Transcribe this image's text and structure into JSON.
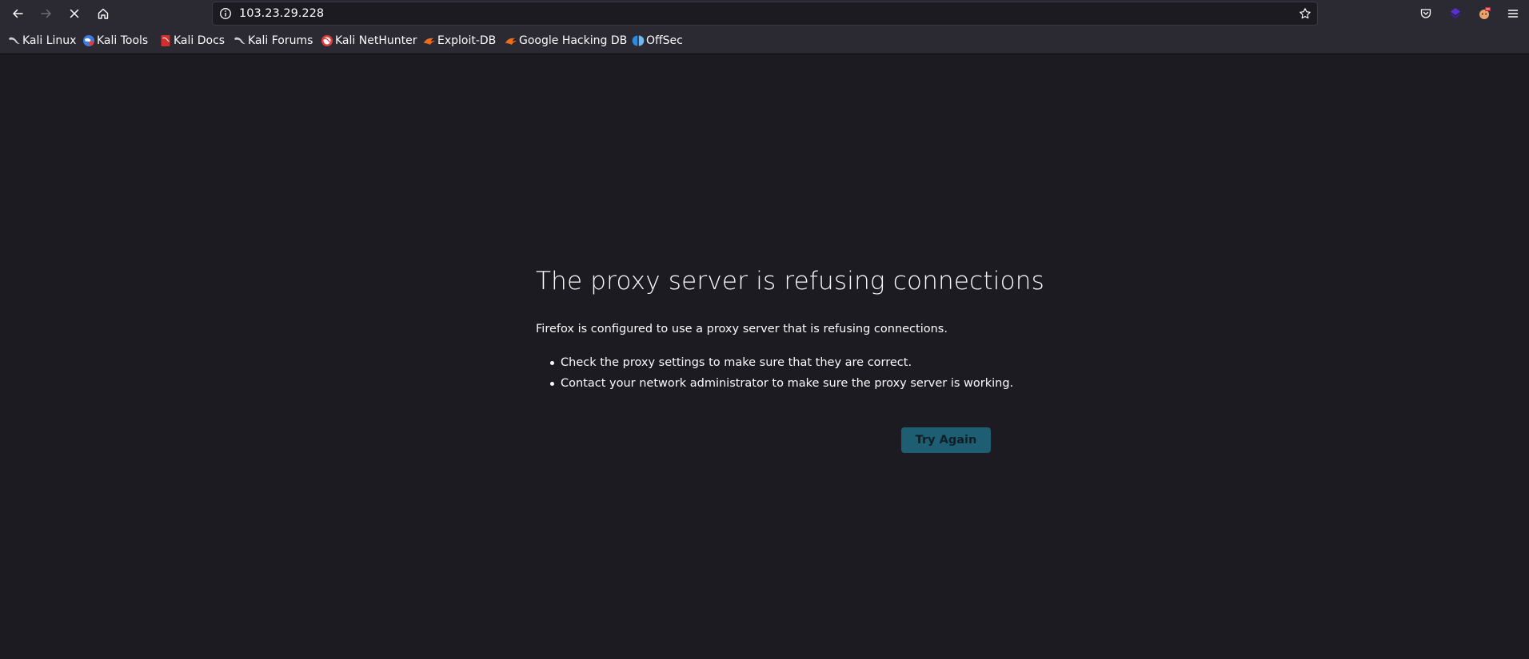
{
  "toolbar": {
    "url": "103.23.29.228",
    "icons": {
      "back": "back-arrow-icon",
      "forward": "forward-arrow-icon",
      "stop": "stop-loading-icon",
      "home": "home-icon",
      "site_info": "site-info-icon",
      "bookmark_star": "bookmark-star-icon",
      "pocket": "pocket-icon",
      "extension": "extension-icon",
      "profile": "profile-extension-icon",
      "menu": "hamburger-menu-icon"
    }
  },
  "bookmarks": [
    {
      "label": "Kali Linux",
      "icon": "kali-dragon-icon"
    },
    {
      "label": "Kali Tools",
      "icon": "kali-tools-icon"
    },
    {
      "label": "Kali Docs",
      "icon": "kali-docs-icon"
    },
    {
      "label": "Kali Forums",
      "icon": "kali-dragon-icon"
    },
    {
      "label": "Kali NetHunter",
      "icon": "nethunter-icon"
    },
    {
      "label": "Exploit-DB",
      "icon": "exploit-db-icon"
    },
    {
      "label": "Google Hacking DB",
      "icon": "exploit-db-icon"
    },
    {
      "label": "OffSec",
      "icon": "offsec-icon"
    }
  ],
  "error": {
    "title": "The proxy server is refusing connections",
    "description": "Firefox is configured to use a proxy server that is refusing connections.",
    "suggestions": [
      "Check the proxy settings to make sure that they are correct.",
      "Contact your network administrator to make sure the proxy server is working."
    ],
    "button_label": "Try Again"
  },
  "colors": {
    "page_background": "#1c1b22",
    "chrome_background": "#2b2a33",
    "button_background": "#1d5e73",
    "text": "#fbfbfe"
  }
}
